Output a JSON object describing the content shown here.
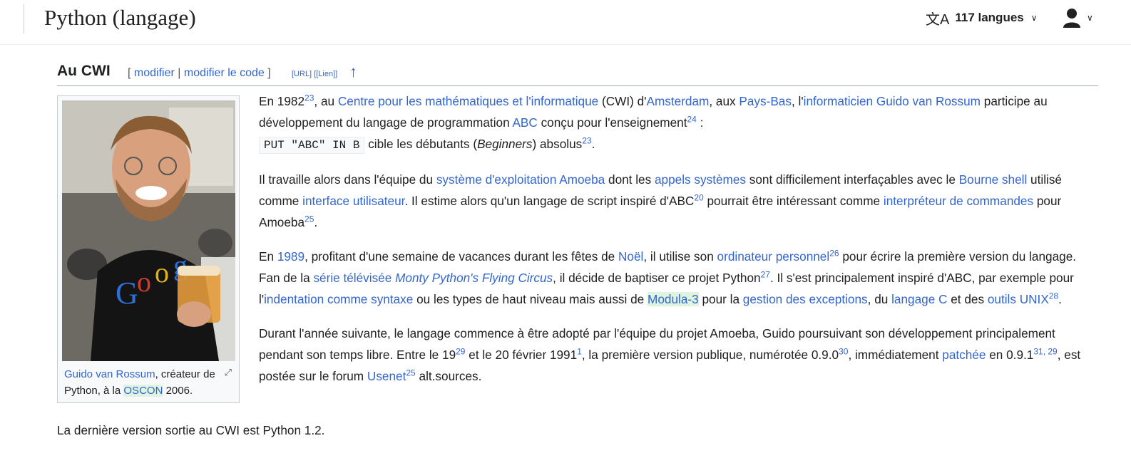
{
  "header": {
    "title": "Python (langage)",
    "languages_label": "117 langues"
  },
  "section": {
    "title": "Au CWI",
    "edit": "modifier",
    "edit_code": "modifier le code",
    "url_link": "[URL]",
    "lien_link": "[[Lien]]",
    "bracket_open": "[",
    "bracket_close": "]",
    "separator": "|",
    "up_arrow": "↑"
  },
  "figure": {
    "caption_link": "Guido van Rossum",
    "caption_mid": ", créateur de Python, à la ",
    "caption_oscon": "OSCON",
    "caption_end": " 2006."
  },
  "paragraphs": {
    "p1": {
      "t1": "En 1982",
      "s1": "23",
      "t2": ", au ",
      "l1": "Centre pour les mathématiques et l'informatique",
      "t3": " (CWI) d'",
      "l2": "Amsterdam",
      "t4": ", aux ",
      "l3": "Pays-Bas",
      "t5": ", l'",
      "l4": "informaticien Guido van Rossum",
      "t6": " participe au développement du langage de programmation ",
      "l5": "ABC",
      "t7": " conçu pour l'enseignement",
      "s2": "24",
      "t8": " : ",
      "code": "PUT \"ABC\" IN B",
      "t9": " cible les débutants (",
      "em": "Beginners",
      "t10": ") absolus",
      "s3": "23",
      "t11": "."
    },
    "p2": {
      "t1": "Il travaille alors dans l'équipe du ",
      "l1": "système d'exploitation Amoeba",
      "t2": " dont les ",
      "l2": "appels systèmes",
      "t3": " sont difficilement interfaçables avec le ",
      "l3": "Bourne shell",
      "t4": " utilisé comme ",
      "l4": "interface utilisateur",
      "t5": ". Il estime alors qu'un langage de script inspiré d'ABC",
      "s1": "20",
      "t6": " pourrait être intéressant comme ",
      "l5": "interpréteur de commandes",
      "t7": " pour Amoeba",
      "s2": "25",
      "t8": "."
    },
    "p3": {
      "t1": "En ",
      "l1": "1989",
      "t2": ", profitant d'une semaine de vacances durant les fêtes de ",
      "l2": "Noël",
      "t3": ", il utilise son ",
      "l3": "ordinateur personnel",
      "s1": "26",
      "t4": " pour écrire la première version du langage. Fan de la ",
      "l4": "série télévisée",
      "t5": " ",
      "l5": "Monty Python's Flying Circus",
      "t6": ", il décide de baptiser ce projet Python",
      "s2": "27",
      "t7": ". Il s'est principalement inspiré d'ABC, par exemple pour l'",
      "l6": "indentation comme syntaxe",
      "t8": " ou les types de haut niveau mais aussi de ",
      "l7": "Modula-3",
      "t9": " pour la ",
      "l8": "gestion des exceptions",
      "t10": ", du ",
      "l9": "langage C",
      "t11": " et des ",
      "l10": "outils UNIX",
      "s3": "28",
      "t12": "."
    },
    "p4": {
      "t1": "Durant l'année suivante, le langage commence à être adopté par l'équipe du projet Amoeba, Guido poursuivant son développement principalement pendant son temps libre. Entre le 19",
      "s1": "29",
      "t2": " et le 20 février 1991",
      "s2": "1",
      "t3": ", la première version publique, numérotée 0.9.0",
      "s3": "30",
      "t4": ", immédiatement ",
      "l1": "patchée",
      "t5": " en 0.9.1",
      "s4": "31, 29",
      "t6": ", est postée sur le forum ",
      "l2": "Usenet",
      "s5": "25",
      "t7": " alt.sources."
    },
    "last": "La dernière version sortie au CWI est Python 1.2."
  },
  "icons": {
    "translate": "translate-icon",
    "user": "user-icon",
    "chevron": "chevron-down-icon",
    "enlarge": "enlarge-icon"
  },
  "colors": {
    "link": "#3366cc",
    "visited_highlight": "#dff3e1",
    "text": "#202122"
  }
}
